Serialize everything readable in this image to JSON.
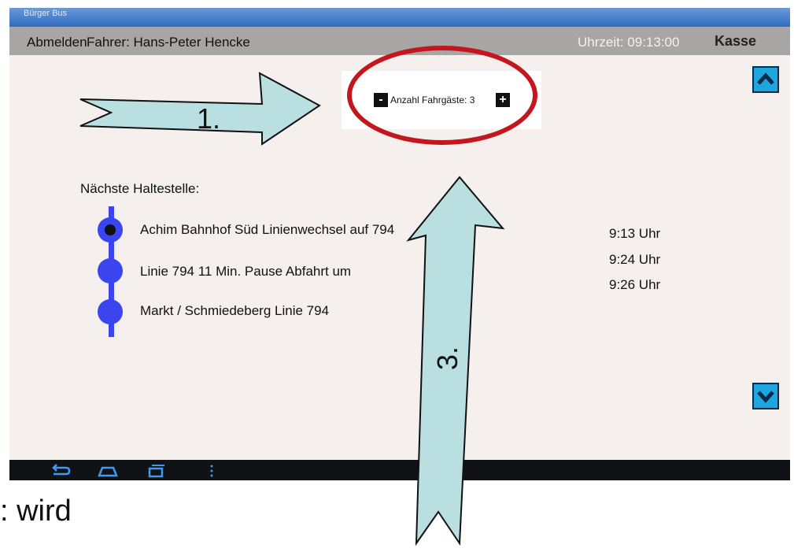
{
  "window": {
    "title": "Bürger Bus"
  },
  "header": {
    "logout_label": "Abmelden",
    "driver": "Fahrer: Hans-Peter Hencke",
    "clock": "Uhrzeit: 09:13:00",
    "kasse_label": "Kasse"
  },
  "passengers": {
    "minus": "-",
    "label": "Anzahl Fahrgäste: 3",
    "plus": "+"
  },
  "stops": {
    "heading": "Nächste Haltestelle:",
    "items": [
      {
        "name": "Achim Bahnhof Süd Linienwechsel auf 794"
      },
      {
        "name": "Linie 794 11 Min. Pause   Abfahrt um"
      },
      {
        "name": "Markt / Schmiedeberg Linie 794"
      }
    ],
    "times": [
      "9:13 Uhr",
      "9:24 Uhr",
      "9:26 Uhr"
    ]
  },
  "annotations": {
    "arrow1": "1.",
    "arrow3": "3.",
    "footer_text": ": wird"
  },
  "navbar": {
    "icons": [
      "back-icon",
      "home-icon",
      "recent-apps-icon",
      "menu-dots-icon"
    ]
  },
  "colors": {
    "topbar": "#a8a6a4",
    "screen_bg": "#f5efed",
    "stop_blue": "#3a45f0",
    "scroll_button": "#1ea6e0",
    "arrow_fill": "#b9dfe0",
    "highlight_red": "#c4161f"
  }
}
